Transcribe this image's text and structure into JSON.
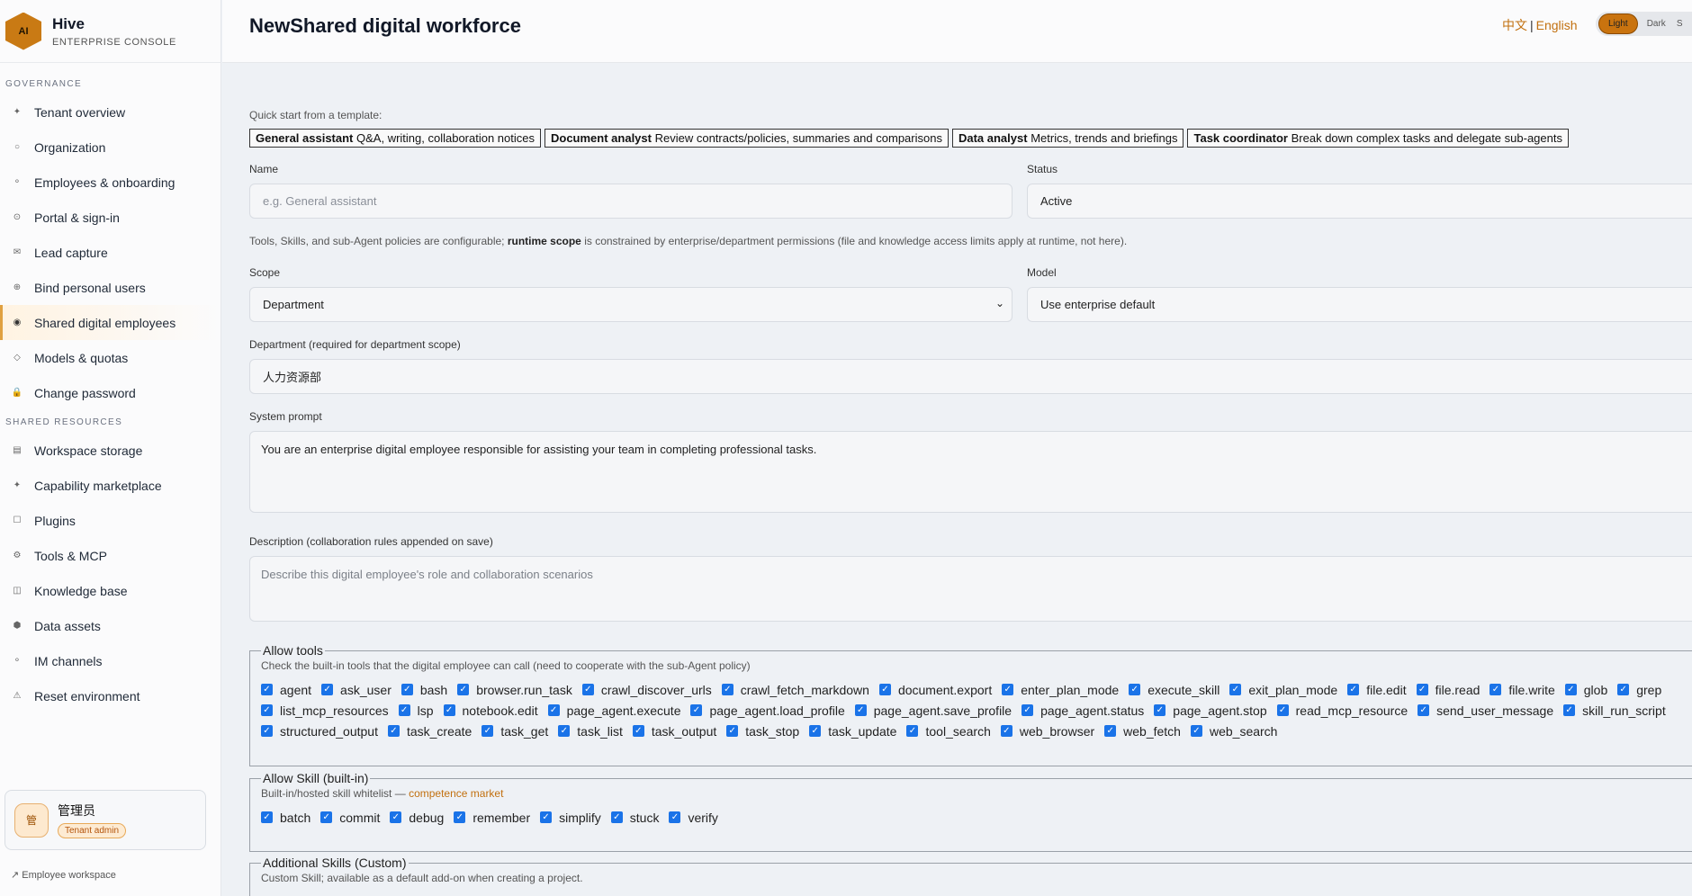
{
  "brand": {
    "logo_text": "AI",
    "name": "Hive",
    "subtitle": "ENTERPRISE CONSOLE"
  },
  "sidebar": {
    "governance_label": "GOVERNANCE",
    "governance_items": [
      {
        "label": "Tenant overview",
        "icon": "✦"
      },
      {
        "label": "Organization",
        "icon": "○"
      },
      {
        "label": "Employees & onboarding",
        "icon": "⚬"
      },
      {
        "label": "Portal & sign-in",
        "icon": "⊙"
      },
      {
        "label": "Lead capture",
        "icon": "✉"
      },
      {
        "label": "Bind personal users",
        "icon": "⊕"
      },
      {
        "label": "Shared digital employees",
        "icon": "◉",
        "active": true
      },
      {
        "label": "Models & quotas",
        "icon": "◇"
      },
      {
        "label": "Change password",
        "icon": "🔒"
      }
    ],
    "resources_label": "SHARED RESOURCES",
    "resources_items": [
      {
        "label": "Workspace storage",
        "icon": "▤"
      },
      {
        "label": "Capability marketplace",
        "icon": "✦"
      },
      {
        "label": "Plugins",
        "icon": "☐"
      },
      {
        "label": "Tools & MCP",
        "icon": "⚙"
      },
      {
        "label": "Knowledge base",
        "icon": "◫"
      },
      {
        "label": "Data assets",
        "icon": "⬢"
      },
      {
        "label": "IM channels",
        "icon": "⚬"
      },
      {
        "label": "Reset environment",
        "icon": "⚠"
      }
    ],
    "user": {
      "avatar": "管",
      "name": "管理员",
      "role": "Tenant admin"
    },
    "employee_workspace": "↗ Employee workspace"
  },
  "header": {
    "title": "NewShared digital workforce",
    "lang_zh": "中文",
    "lang_sep": "|",
    "lang_en": "English",
    "theme": {
      "light": "Light",
      "dark": "Dark",
      "system": "S"
    }
  },
  "form": {
    "quick_start_label": "Quick start from a template:",
    "templates": [
      {
        "name": "General assistant",
        "desc": "Q&A, writing, collaboration notices"
      },
      {
        "name": "Document analyst",
        "desc": "Review contracts/policies, summaries and comparisons"
      },
      {
        "name": "Data analyst",
        "desc": "Metrics, trends and briefings"
      },
      {
        "name": "Task coordinator",
        "desc": "Break down complex tasks and delegate sub-agents"
      }
    ],
    "name_label": "Name",
    "name_placeholder": "e.g. General assistant",
    "status_label": "Status",
    "status_value": "Active",
    "policy_hint_pre": "Tools, Skills, and sub-Agent policies are configurable; ",
    "policy_hint_bold": "runtime scope",
    "policy_hint_post": " is constrained by enterprise/department permissions (file and knowledge access limits apply at runtime, not here).",
    "scope_label": "Scope",
    "scope_value": "Department",
    "model_label": "Model",
    "model_value": "Use enterprise default",
    "department_label": "Department (required for department scope)",
    "department_value": "人力资源部",
    "system_prompt_label": "System prompt",
    "system_prompt_value": "You are an enterprise digital employee responsible for assisting your team in completing professional tasks.",
    "description_label": "Description (collaboration rules appended on save)",
    "description_placeholder": "Describe this digital employee's role and collaboration scenarios"
  },
  "allow_tools": {
    "legend": "Allow tools",
    "description": "Check the built-in tools that the digital employee can call (need to cooperate with the sub-Agent policy)",
    "items": [
      "agent",
      "ask_user",
      "bash",
      "browser.run_task",
      "crawl_discover_urls",
      "crawl_fetch_markdown",
      "document.export",
      "enter_plan_mode",
      "execute_skill",
      "exit_plan_mode",
      "file.edit",
      "file.read",
      "file.write",
      "glob",
      "grep",
      "list_mcp_resources",
      "lsp",
      "notebook.edit",
      "page_agent.execute",
      "page_agent.load_profile",
      "page_agent.save_profile",
      "page_agent.status",
      "page_agent.stop",
      "read_mcp_resource",
      "send_user_message",
      "skill_run_script",
      "structured_output",
      "task_create",
      "task_get",
      "task_list",
      "task_output",
      "task_stop",
      "task_update",
      "tool_search",
      "web_browser",
      "web_fetch",
      "web_search"
    ]
  },
  "allow_skill": {
    "legend": "Allow Skill (built-in)",
    "description_pre": "Built-in/hosted skill whitelist — ",
    "description_link": "competence market",
    "items": [
      "batch",
      "commit",
      "debug",
      "remember",
      "simplify",
      "stuck",
      "verify"
    ]
  },
  "additional_skills": {
    "legend": "Additional Skills (Custom)",
    "description": "Custom Skill; available as a default add-on when creating a project."
  }
}
